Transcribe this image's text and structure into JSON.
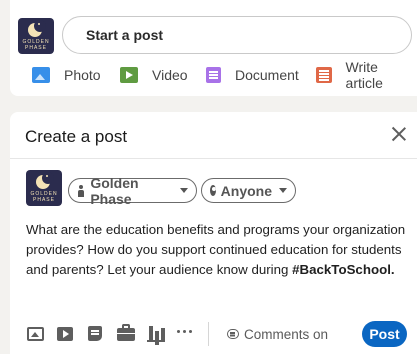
{
  "share_box": {
    "brand_logo_text": [
      "GOLDEN",
      "PHASE"
    ],
    "start_post_placeholder": "Start a post",
    "actions": [
      {
        "label": "Photo",
        "icon": "photo-icon",
        "color": "#378fe9"
      },
      {
        "label": "Video",
        "icon": "video-icon",
        "color": "#5f9b41"
      },
      {
        "label": "Document",
        "icon": "document-icon",
        "color": "#a872e8"
      },
      {
        "label": "Write article",
        "icon": "article-icon",
        "color": "#e06847"
      }
    ]
  },
  "modal": {
    "title": "Create a post",
    "close_icon": "close-icon",
    "author": "Golden Phase",
    "audience": "Anyone",
    "post_text": "What are the education benefits and programs your organization provides? How do you support continued education for students and parents? Let your audience know during ",
    "hashtag": "#BackToSchool.",
    "toolbar_icons": [
      "image-icon",
      "video-icon",
      "document-icon",
      "job-icon",
      "poll-icon",
      "more-icon"
    ],
    "comments_label": "Comments on",
    "post_button": "Post",
    "post_button_color": "#0a66c2"
  }
}
